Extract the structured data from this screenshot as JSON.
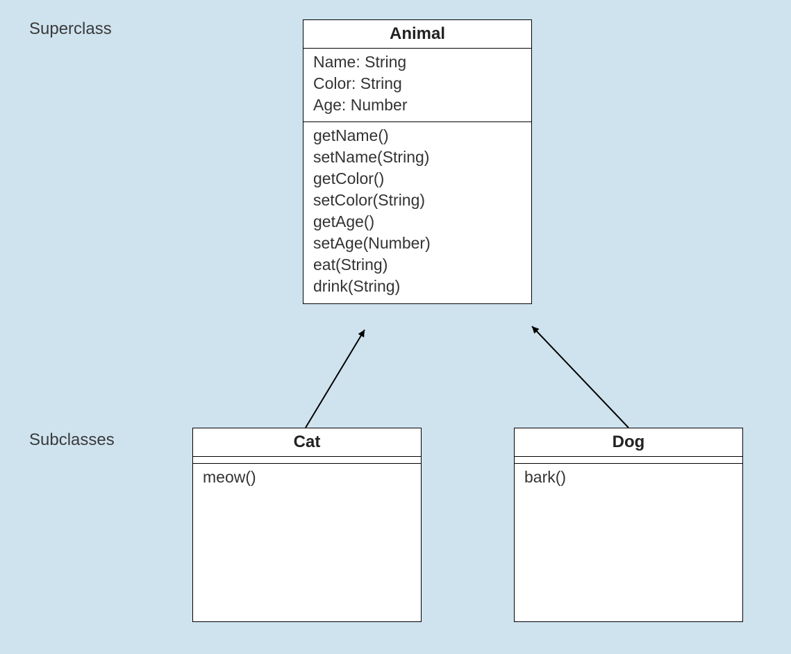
{
  "labels": {
    "superclass": "Superclass",
    "subclasses": "Subclasses"
  },
  "classes": {
    "animal": {
      "name": "Animal",
      "attributes": [
        "Name: String",
        "Color: String",
        "Age: Number"
      ],
      "methods": [
        "getName()",
        "setName(String)",
        "getColor()",
        "setColor(String)",
        "getAge()",
        "setAge(Number)",
        "eat(String)",
        "drink(String)"
      ]
    },
    "cat": {
      "name": "Cat",
      "methods": [
        "meow()"
      ]
    },
    "dog": {
      "name": "Dog",
      "methods": [
        "bark()"
      ]
    }
  }
}
